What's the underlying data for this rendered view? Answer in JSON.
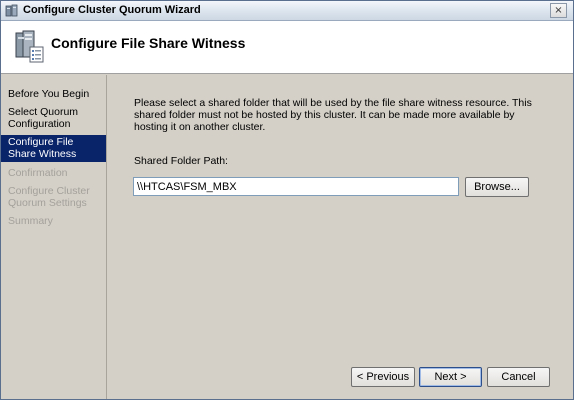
{
  "window": {
    "title": "Configure Cluster Quorum Wizard",
    "close_glyph": "×"
  },
  "header": {
    "title": "Configure File Share Witness",
    "icon": "cluster-servers-icon"
  },
  "sidebar": {
    "items": [
      {
        "label": "Before You Begin",
        "state": "normal"
      },
      {
        "label": "Select Quorum Configuration",
        "state": "normal"
      },
      {
        "label": "Configure File Share Witness",
        "state": "active"
      },
      {
        "label": "Confirmation",
        "state": "disabled"
      },
      {
        "label": "Configure Cluster Quorum Settings",
        "state": "disabled"
      },
      {
        "label": "Summary",
        "state": "disabled"
      }
    ]
  },
  "main": {
    "description": "Please select a shared folder that will be used by the file share witness resource.  This shared folder must not be hosted by this cluster.  It can be made more available by hosting it on another cluster.",
    "field_label": "Shared Folder Path:",
    "path_value": "\\\\HTCAS\\FSM_MBX",
    "browse_label": "Browse..."
  },
  "footer": {
    "previous_label": "< Previous",
    "next_label": "Next >",
    "cancel_label": "Cancel"
  },
  "colors": {
    "active_nav": "#0a246a",
    "disabled_text": "#a4a19b",
    "dialog_bg": "#d4d0c8"
  }
}
